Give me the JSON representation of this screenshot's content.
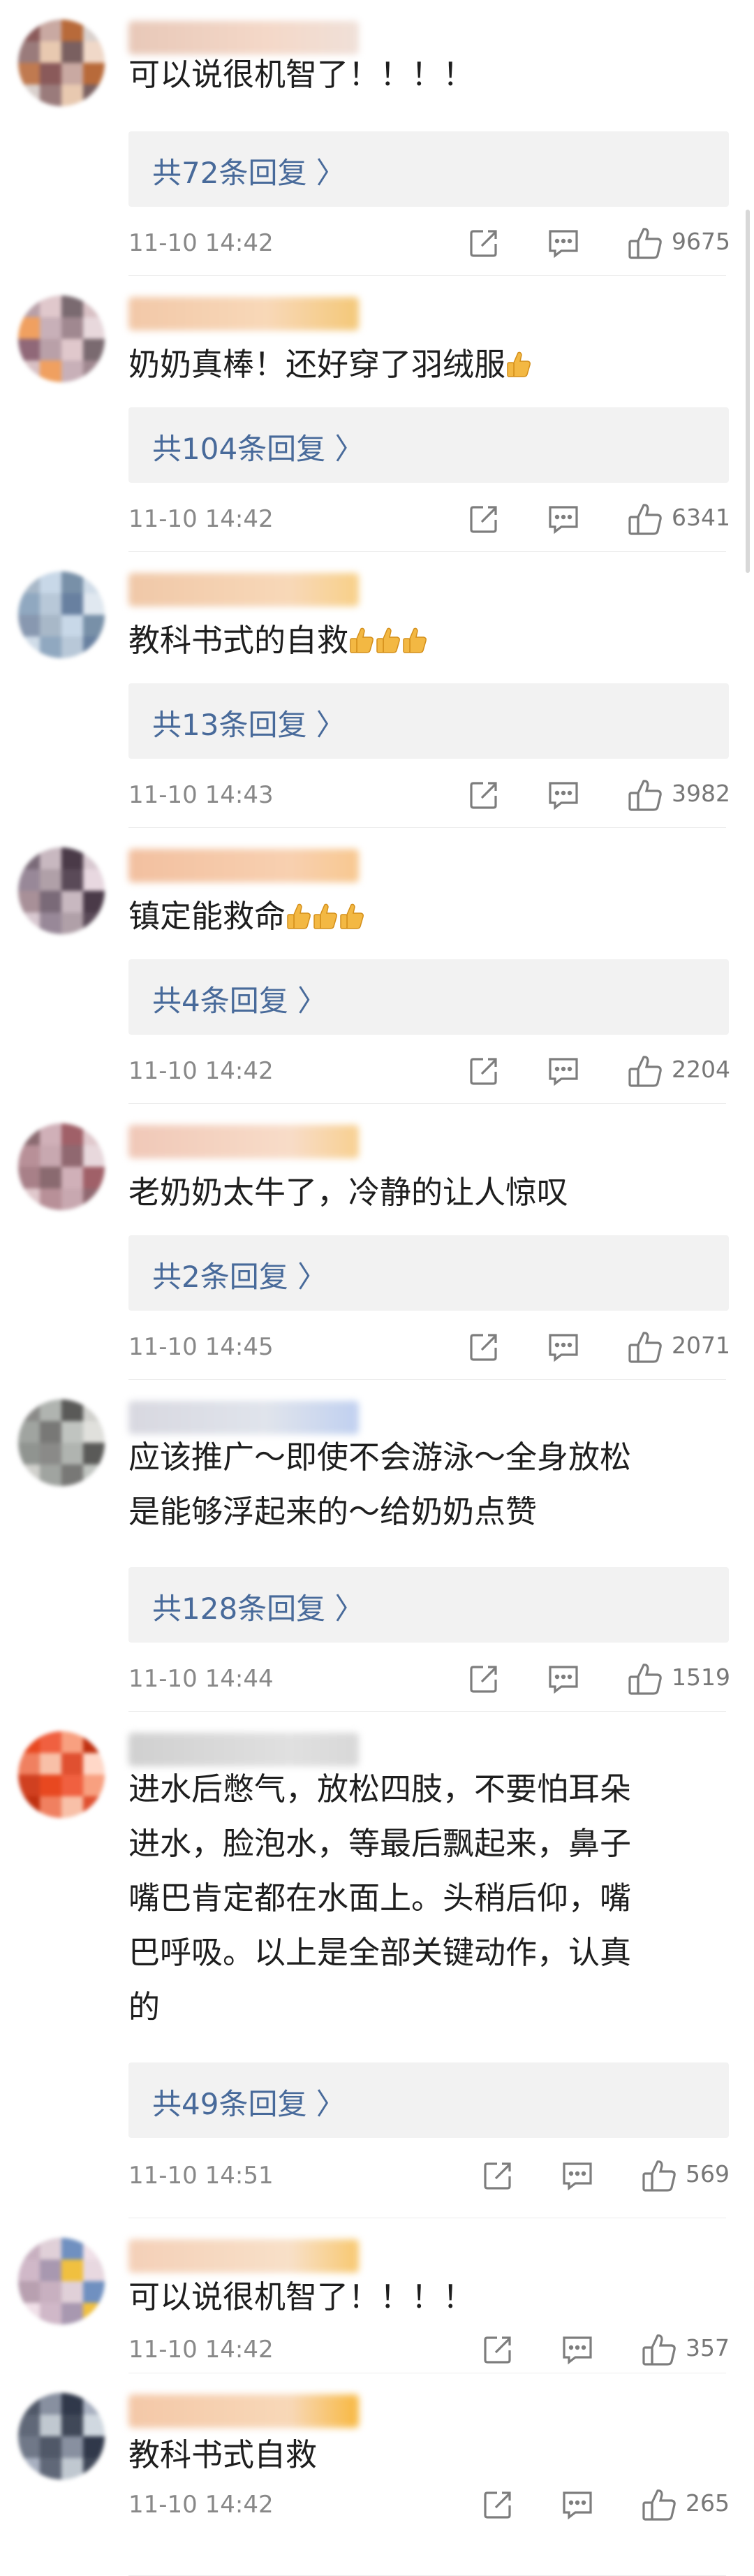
{
  "reply_suffix": " >",
  "icons": {
    "share": "share-icon",
    "comment": "comment-icon",
    "like": "thumbs-up-icon",
    "emoji": "thumbs-up-emoji"
  },
  "colors": {
    "reply_link": "#486a9a",
    "reply_bg": "#f2f2f2",
    "meta": "#888888"
  },
  "comments": [
    {
      "text": "可以说很机智了！！！！",
      "emoji_count": 0,
      "reply": "共72条回复 〉",
      "time": "11-10 14:42",
      "likes": "9675"
    },
    {
      "text": "奶奶真棒！还好穿了羽绒服",
      "emoji_count": 1,
      "reply": "共104条回复 〉",
      "time": "11-10 14:42",
      "likes": "6341"
    },
    {
      "text": "教科书式的自救",
      "emoji_count": 3,
      "reply": "共13条回复 〉",
      "time": "11-10 14:43",
      "likes": "3982"
    },
    {
      "text": "镇定能救命",
      "emoji_count": 3,
      "reply": "共4条回复 〉",
      "time": "11-10 14:42",
      "likes": "2204"
    },
    {
      "text": "老奶奶太牛了，冷静的让人惊叹",
      "emoji_count": 0,
      "reply": "共2条回复 〉",
      "time": "11-10 14:45",
      "likes": "2071"
    },
    {
      "text": "应该推广～即使不会游泳～全身放松\n是能够浮起来的～给奶奶点赞",
      "emoji_count": 0,
      "reply": "共128条回复 〉",
      "time": "11-10 14:44",
      "likes": "1519"
    },
    {
      "text": "进水后憋气，放松四肢，不要怕耳朵\n进水，脸泡水，等最后飘起来，鼻子\n嘴巴肯定都在水面上。头稍后仰，嘴\n巴呼吸。以上是全部关键动作，认真\n的",
      "emoji_count": 0,
      "reply": "共49条回复 〉",
      "time": "11-10 14:51",
      "likes": "569"
    },
    {
      "text": "可以说很机智了！！！！",
      "emoji_count": 0,
      "reply": "",
      "time": "11-10 14:42",
      "likes": "357"
    },
    {
      "text": "教科书式自救",
      "emoji_count": 0,
      "reply": "",
      "time": "11-10 14:42",
      "likes": "265"
    }
  ]
}
